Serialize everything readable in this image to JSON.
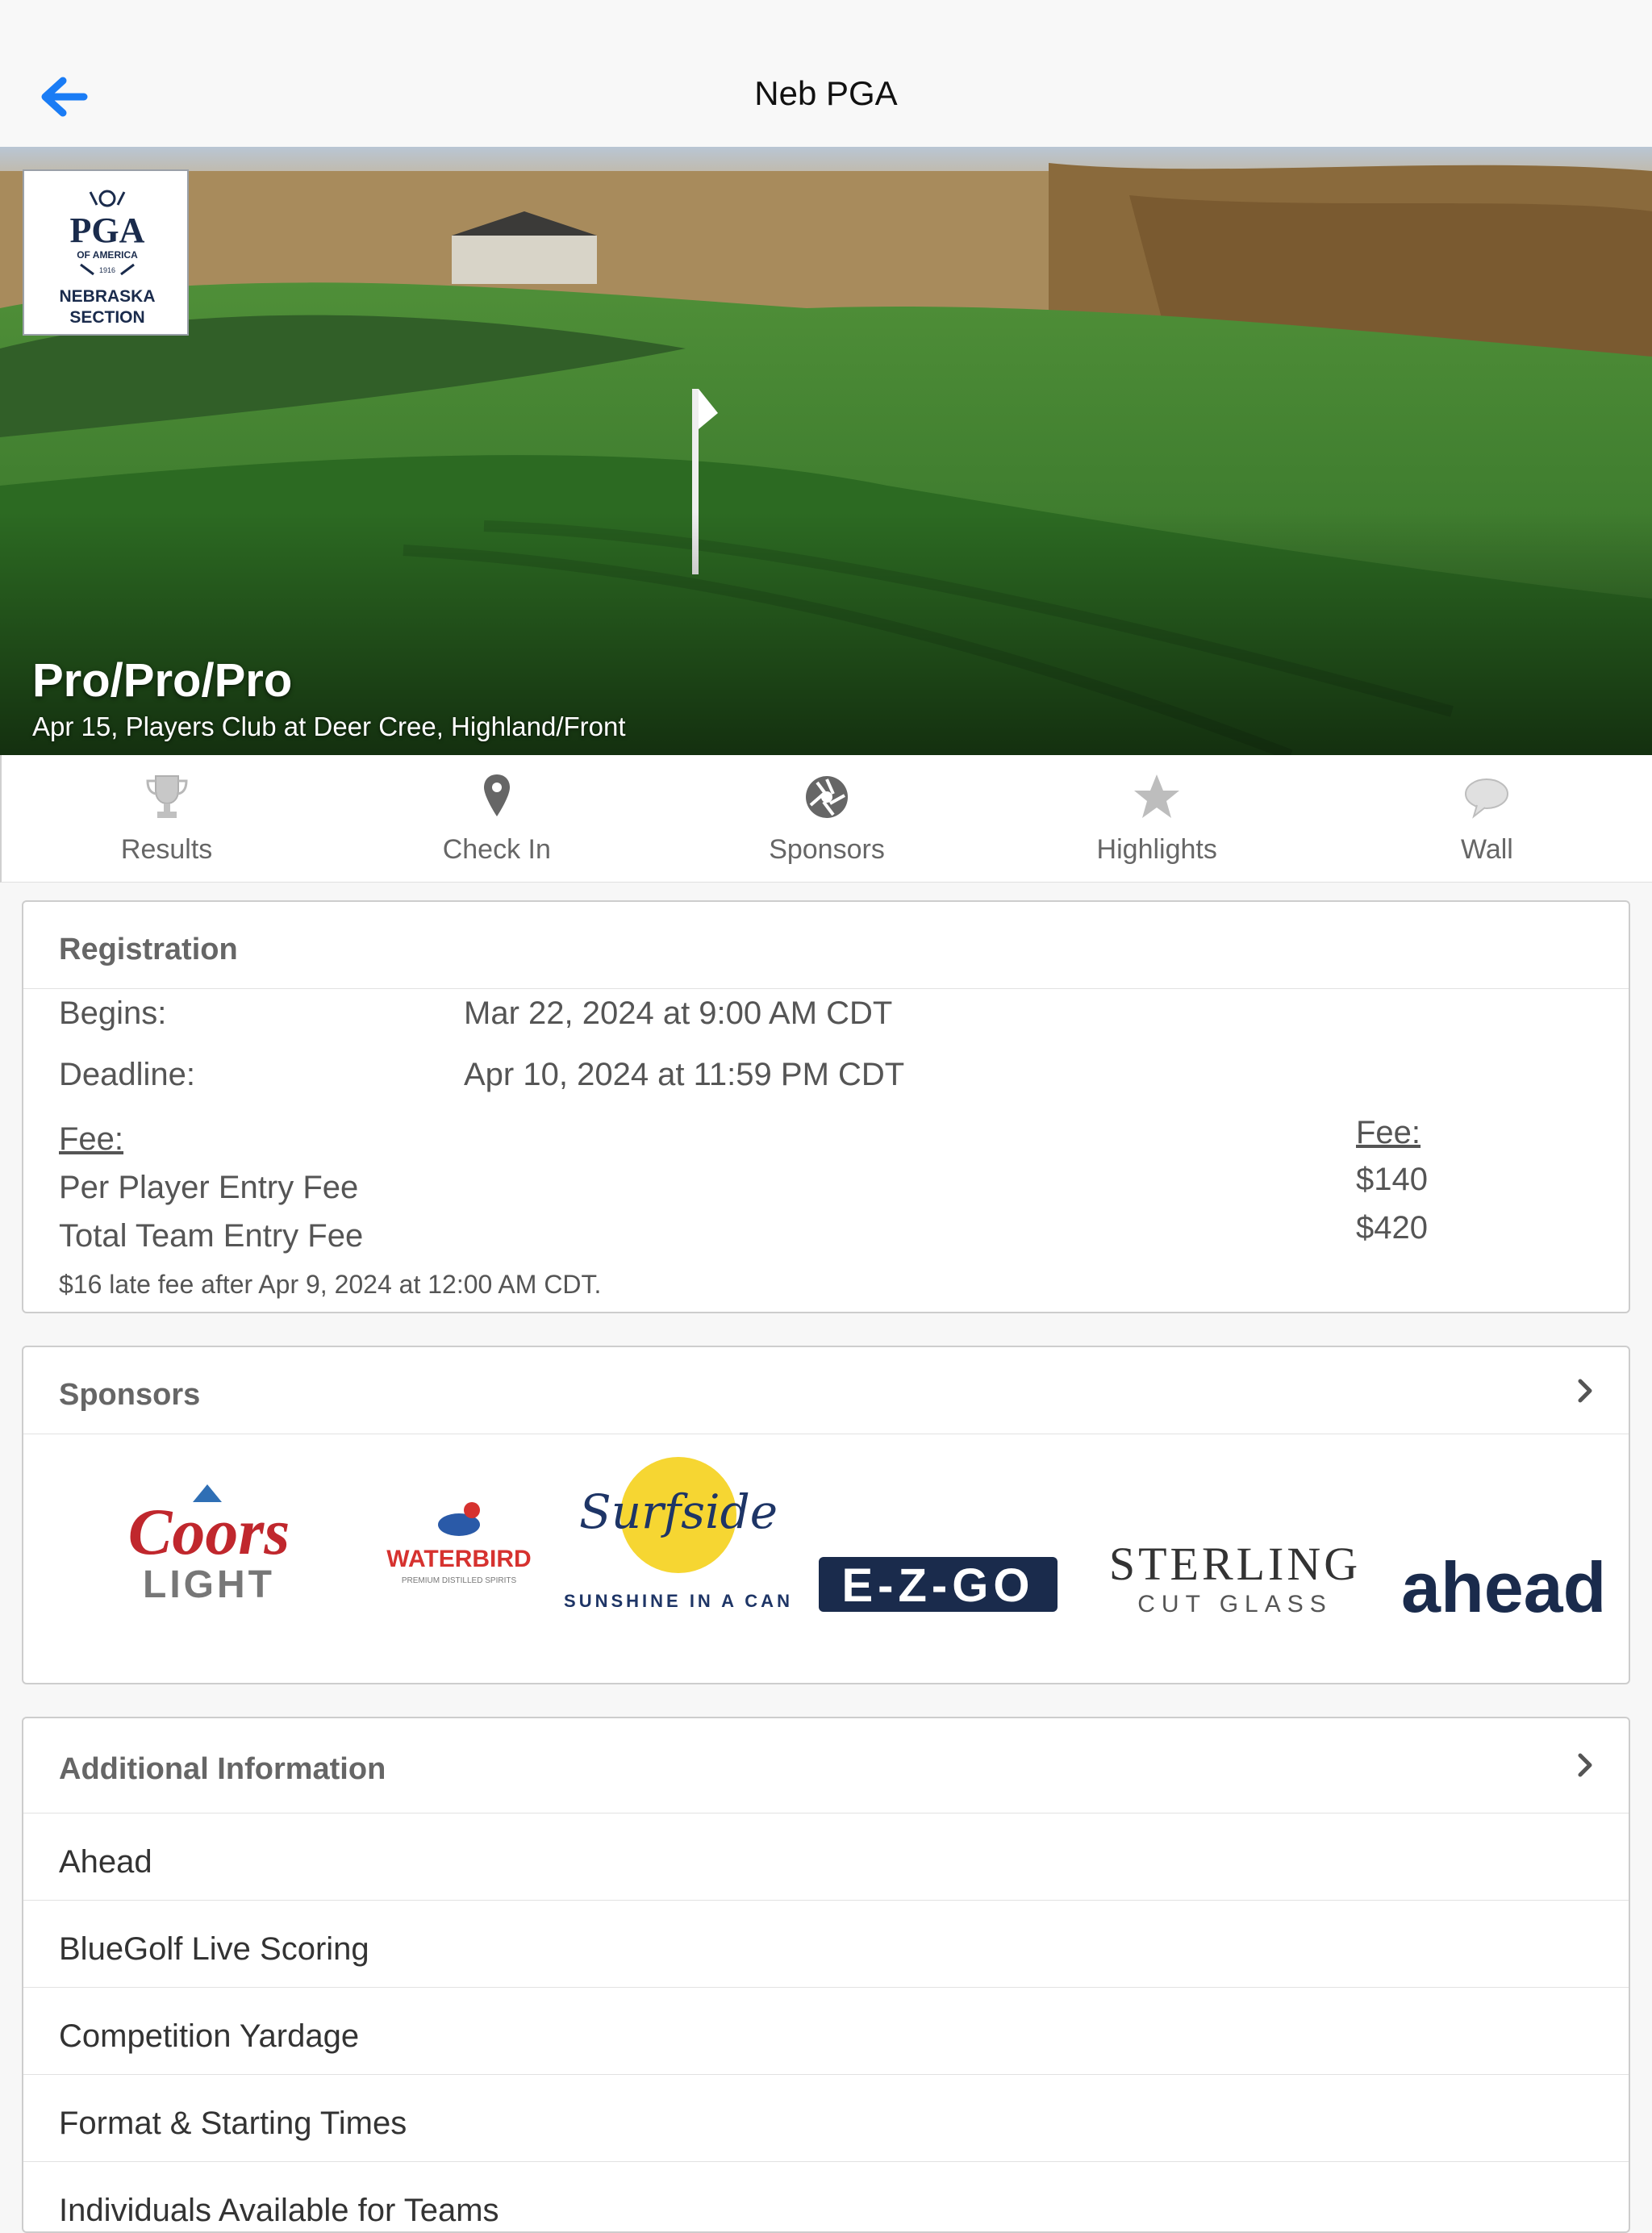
{
  "nav": {
    "title": "Neb PGA",
    "back_icon": "arrow-left-icon"
  },
  "hero": {
    "title": "Pro/Pro/Pro",
    "subtitle": "Apr 15, Players Club at Deer Cree, Highland/Front",
    "logo": {
      "line1": "PGA",
      "line2": "OF AMERICA",
      "line3": "1916",
      "line4": "NEBRASKA",
      "line5": "SECTION"
    }
  },
  "tabs": [
    {
      "label": "Results",
      "icon": "trophy-icon"
    },
    {
      "label": "Check In",
      "icon": "map-pin-icon"
    },
    {
      "label": "Sponsors",
      "icon": "aperture-icon"
    },
    {
      "label": "Highlights",
      "icon": "star-icon"
    },
    {
      "label": "Wall",
      "icon": "speech-bubble-icon"
    }
  ],
  "registration": {
    "header": "Registration",
    "begins_label": "Begins:",
    "begins_value": "Mar 22, 2024 at 9:00 AM CDT",
    "deadline_label": "Deadline:",
    "deadline_value": "Apr 10, 2024 at 11:59 PM CDT",
    "fee_heading": "Fee:",
    "fee_items": [
      "Per Player Entry Fee",
      "Total Team Entry Fee"
    ],
    "fee_value_heading": "Fee:",
    "fee_values": [
      "$140",
      "$420"
    ],
    "note": "$16 late fee after Apr 9, 2024 at 12:00 AM CDT."
  },
  "sponsors": {
    "header": "Sponsors",
    "logos": [
      {
        "name": "coors-light",
        "lines": [
          "Coors",
          "LIGHT"
        ]
      },
      {
        "name": "waterbird",
        "lines": [
          "WATERBIRD",
          "PREMIUM DISTILLED SPIRITS"
        ]
      },
      {
        "name": "surfside",
        "lines": [
          "Surfside",
          "SUNSHINE IN A CAN"
        ]
      },
      {
        "name": "ezgo",
        "lines": [
          "E-Z-GO"
        ]
      },
      {
        "name": "sterling",
        "lines": [
          "STERLING",
          "CUT GLASS"
        ]
      },
      {
        "name": "ahead",
        "lines": [
          "ahead"
        ]
      }
    ]
  },
  "additional": {
    "header": "Additional Information",
    "items": [
      "Ahead",
      "BlueGolf Live Scoring",
      "Competition Yardage",
      "Format & Starting Times",
      "Individuals Available for Teams"
    ]
  },
  "colors": {
    "accent": "#1a7cf5",
    "navy": "#1a2b4c",
    "grass": "#3f7d2c"
  }
}
